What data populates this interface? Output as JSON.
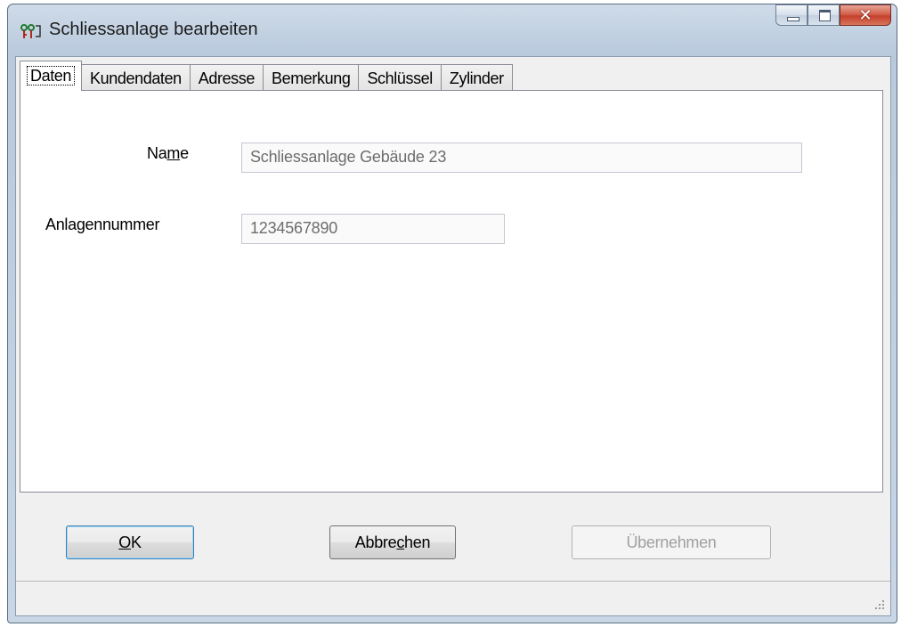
{
  "window": {
    "title": "Schliessanlage bearbeiten",
    "icon": "keys-app-icon",
    "controls": {
      "minimize": "minimize-icon",
      "maximize": "maximize-icon",
      "close": "✕"
    }
  },
  "tabs": [
    {
      "label": "Daten",
      "active": true
    },
    {
      "label": "Kundendaten",
      "active": false
    },
    {
      "label": "Adresse",
      "active": false
    },
    {
      "label": "Bemerkung",
      "active": false
    },
    {
      "label": "Schlüssel",
      "active": false
    },
    {
      "label": "Zylinder",
      "active": false
    }
  ],
  "form": {
    "name_label_pre": "Na",
    "name_label_mnemonic": "m",
    "name_label_post": "e",
    "name_value": "Schliessanlage Gebäude 23",
    "number_label": "Anlagennummer",
    "number_value": "1234567890"
  },
  "buttons": {
    "ok_mnemonic": "O",
    "ok_rest": "K",
    "cancel_pre": "Abbre",
    "cancel_mnemonic": "c",
    "cancel_post": "hen",
    "apply_label": "Übernehmen",
    "apply_enabled": false
  }
}
